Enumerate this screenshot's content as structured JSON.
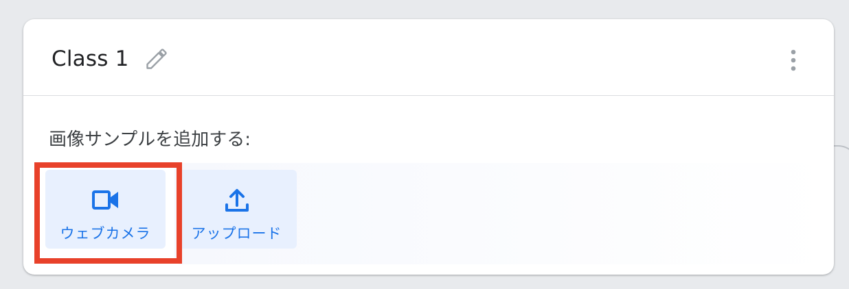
{
  "card": {
    "class_name": "Class 1",
    "edit_icon": "pencil-icon",
    "menu_icon": "more-vertical-icon"
  },
  "samples": {
    "add_label": "画像サンプルを追加する:",
    "buttons": [
      {
        "label": "ウェブカメラ",
        "icon": "video-camera-icon"
      },
      {
        "label": "アップロード",
        "icon": "upload-icon"
      }
    ]
  },
  "colors": {
    "accent": "#1a73e8",
    "button_bg": "#e8f0fe",
    "highlight": "#e8412a",
    "page_bg": "#e8eaed"
  }
}
